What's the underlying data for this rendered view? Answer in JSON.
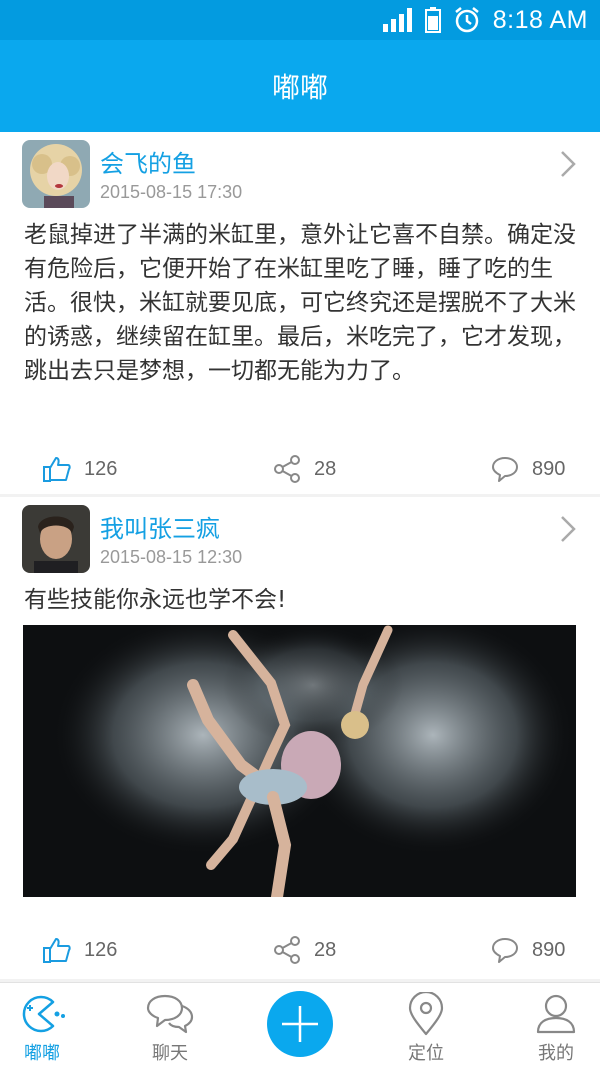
{
  "status_bar": {
    "time": "8:18 AM"
  },
  "header": {
    "title": "嘟嘟"
  },
  "posts": [
    {
      "username": "会飞的鱼",
      "time": "2015-08-15 17:30",
      "text": "老鼠掉进了半满的米缸里，意外让它喜不自禁。确定没有危险后，它便开始了在米缸里吃了睡，睡了吃的生活。很快，米缸就要见底，可它终究还是摆脱不了大米的诱惑，继续留在缸里。最后，米吃完了，它才发现，跳出去只是梦想，一切都无能为力了。",
      "likes": "126",
      "shares": "28",
      "comments": "890"
    },
    {
      "username": "我叫张三疯",
      "time": "2015-08-15 12:30",
      "text": "有些技能你永远也学不会!",
      "likes": "126",
      "shares": "28",
      "comments": "890"
    }
  ],
  "tabs": [
    {
      "label": "嘟嘟",
      "icon": "pacman-icon",
      "active": true
    },
    {
      "label": "聊天",
      "icon": "chat-icon"
    },
    {
      "label": "",
      "icon": "add-icon"
    },
    {
      "label": "定位",
      "icon": "location-icon"
    },
    {
      "label": "我的",
      "icon": "person-icon"
    }
  ],
  "colors": {
    "accent": "#0aa8ee",
    "link": "#14a0e3",
    "status_bar": "#039be0"
  }
}
